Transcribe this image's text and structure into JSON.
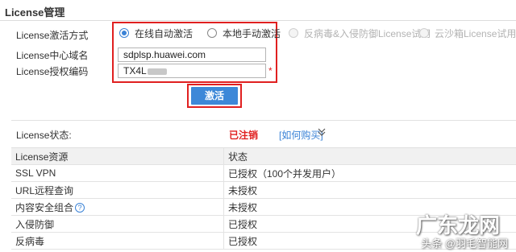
{
  "page": {
    "title": "License管理"
  },
  "form": {
    "activation_mode_label": "License激活方式",
    "modes": [
      {
        "label": "在线自动激活",
        "checked": true,
        "disabled": false
      },
      {
        "label": "本地手动激活",
        "checked": false,
        "disabled": false
      },
      {
        "label": "反病毒&入侵防御License试用",
        "checked": false,
        "disabled": true
      },
      {
        "label": "云沙箱License试用",
        "checked": false,
        "disabled": true
      }
    ],
    "center_domain_label": "License中心域名",
    "center_domain_value": "sdplsp.huawei.com",
    "auth_code_label": "License授权编码",
    "auth_code_value": "TX4L",
    "required_mark": "*",
    "activate_button": "激活"
  },
  "status": {
    "label": "License状态:",
    "value": "已注销",
    "buy_link": "[如何购买]",
    "expand_icon": "double-chevron-down-icon"
  },
  "table": {
    "headers": [
      "License资源",
      "状态"
    ],
    "rows": [
      {
        "resource": "SSL VPN",
        "status": "已授权（100个并发用户）",
        "help": false
      },
      {
        "resource": "URL远程查询",
        "status": "未授权",
        "help": false
      },
      {
        "resource": "内容安全组合",
        "status": "未授权",
        "help": true
      },
      {
        "resource": "入侵防御",
        "status": "已授权",
        "help": false
      },
      {
        "resource": "反病毒",
        "status": "已授权",
        "help": false
      }
    ]
  },
  "watermark": {
    "line1": "广东龙网",
    "line2": "头条 @羽毛智能网"
  },
  "colors": {
    "accent": "#3d88d8",
    "highlight_box": "#e02020",
    "status_error": "#e02020"
  }
}
